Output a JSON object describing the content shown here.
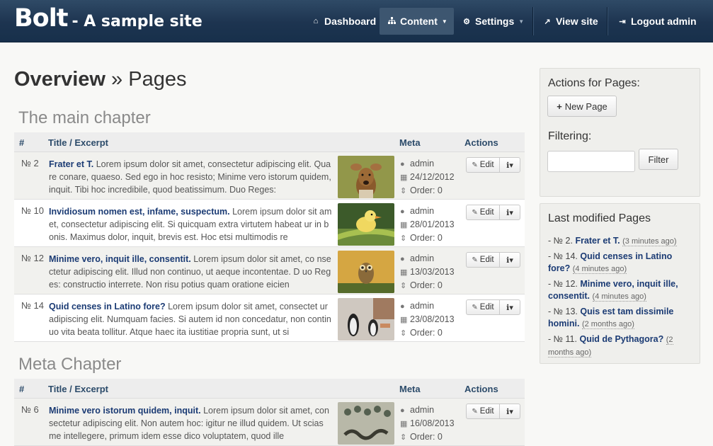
{
  "navbar": {
    "brand_main": "Bolt",
    "brand_sub": "- A sample site",
    "items": [
      {
        "label": "Dashboard",
        "icon": "home-icon"
      },
      {
        "label": "Content",
        "icon": "sitemap-icon",
        "dropdown": true,
        "active": true
      },
      {
        "label": "Settings",
        "icon": "cogs-icon",
        "dropdown": true
      },
      {
        "label": "View site",
        "icon": "external-link-icon"
      },
      {
        "label": "Logout admin",
        "icon": "sign-out-icon"
      }
    ]
  },
  "page": {
    "title_strong": "Overview",
    "title_sep": " » ",
    "title_rest": "Pages"
  },
  "table_headers": {
    "num": "#",
    "title": "Title / Excerpt",
    "meta": "Meta",
    "actions": "Actions"
  },
  "chapters": [
    {
      "title": "The main chapter",
      "rows": [
        {
          "num": "№ 2",
          "title": "Frater et T.",
          "excerpt": "Lorem ipsum dolor sit amet, consectetur adipiscing elit. Quare conare, quaeso. Sed ego in hoc resisto; Minime vero istorum quidem, inquit. Tibi hoc incredibile, quod beatissimum. Duo Reges:",
          "author": "admin",
          "date": "24/12/2012",
          "order": "Order: 0",
          "thumb": "deer"
        },
        {
          "num": "№ 10",
          "title": "Invidiosum nomen est, infame, suspectum.",
          "excerpt": "Lorem ipsum dolor sit amet, consectetur adipiscing elit. Si quicquam extra virtutem habeat ur in bonis. Maximus dolor, inquit, brevis est. Hoc etsi multimodis re",
          "author": "admin",
          "date": "28/01/2013",
          "order": "Order: 0",
          "thumb": "duckling"
        },
        {
          "num": "№ 12",
          "title": "Minime vero, inquit ille, consentit.",
          "excerpt": "Lorem ipsum dolor sit amet, co nsectetur adipiscing elit. Illud non continuo, ut aeque incontentae. D uo Reges: constructio interrete. Non risu potius quam oratione eicien",
          "author": "admin",
          "date": "13/03/2013",
          "order": "Order: 0",
          "thumb": "owl"
        },
        {
          "num": "№ 14",
          "title": "Quid censes in Latino fore?",
          "excerpt": "Lorem ipsum dolor sit amet, consectet ur adipiscing elit. Numquam facies. Si autem id non concedatur, non continuo vita beata tollitur. Atque haec ita iustitiae propria sunt, ut si",
          "author": "admin",
          "date": "23/08/2013",
          "order": "Order: 0",
          "thumb": "penguins"
        }
      ]
    },
    {
      "title": "Meta Chapter",
      "rows": [
        {
          "num": "№ 6",
          "title": "Minime vero istorum quidem, inquit.",
          "excerpt": "Lorem ipsum dolor sit amet, consectetur adipiscing elit. Non autem hoc: igitur ne illud quidem. Ut scias me intellegere, primum idem esse dico voluptatem, quod ille",
          "author": "admin",
          "date": "16/08/2013",
          "order": "Order: 0",
          "thumb": "snake"
        }
      ]
    }
  ],
  "row_actions": {
    "edit_label": "Edit"
  },
  "sidebar": {
    "actions_heading": "Actions for Pages:",
    "new_page_label": "New Page",
    "filter_heading": "Filtering:",
    "filter_value": "",
    "filter_button": "Filter",
    "last_modified_heading": "Last modified Pages",
    "last_modified": [
      {
        "num": "№ 2.",
        "title": "Frater et T.",
        "ago": "(3 minutes ago)"
      },
      {
        "num": "№ 14.",
        "title": "Quid censes in Latino fore?",
        "ago": "(4 minutes ago)"
      },
      {
        "num": "№ 12.",
        "title": "Minime vero, inquit ille, consentit.",
        "ago": "(4 minutes ago)"
      },
      {
        "num": "№ 13.",
        "title": "Quis est tam dissimile homini.",
        "ago": "(2 months ago)"
      },
      {
        "num": "№ 11.",
        "title": "Quid de Pythagora?",
        "ago": "(2 months ago)"
      }
    ]
  }
}
